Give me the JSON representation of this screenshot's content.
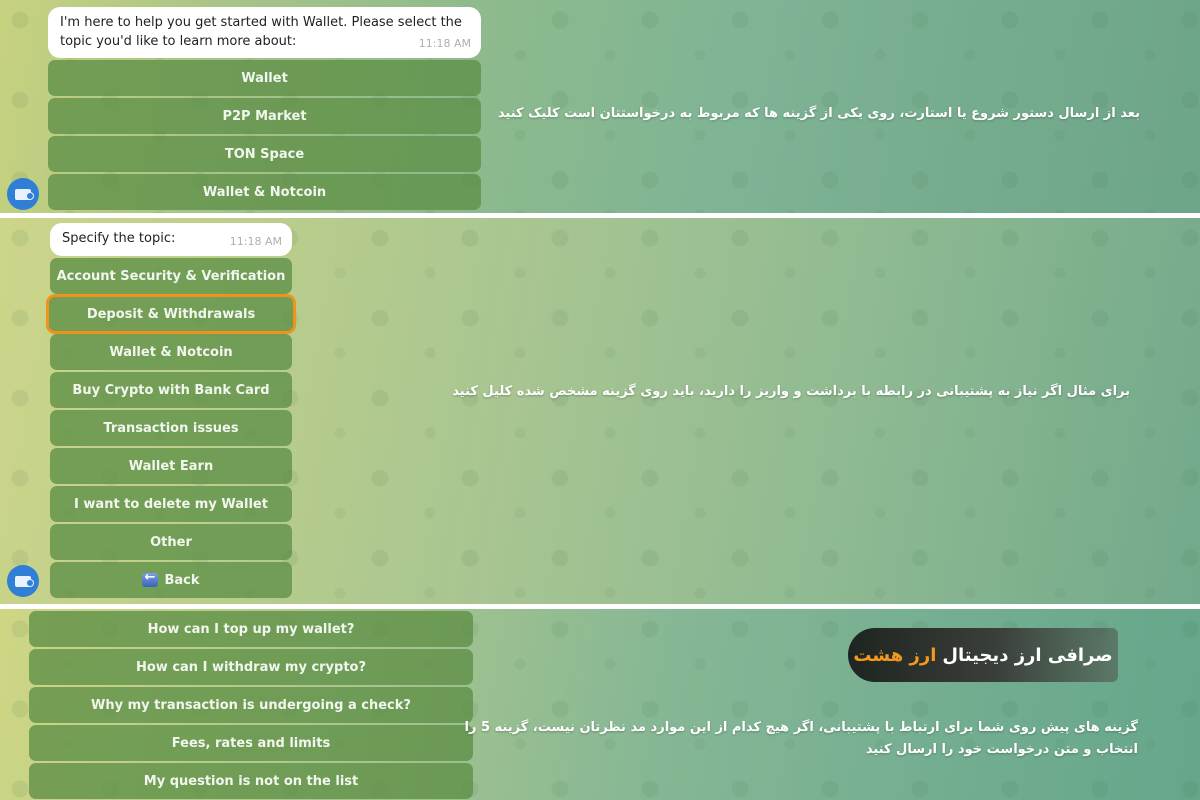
{
  "panel1": {
    "message": "I'm here to help you get started with Wallet. Please select the topic you'd like to learn more about:",
    "time": "11:18 AM",
    "buttons": [
      "Wallet",
      "P2P Market",
      "TON Space",
      "Wallet & Notcoin"
    ],
    "caption": "بعد از ارسال دستور شروع یا استارت، روی یکی از گزینه ها که مربوط به درخواستتان است کلیک کنید",
    "avatar_icon": "wallet-icon"
  },
  "panel2": {
    "message": "Specify the topic:",
    "time": "11:18 AM",
    "buttons": [
      "Account Security & Verification",
      "Deposit & Withdrawals",
      "Wallet & Notcoin",
      "Buy Crypto with Bank Card",
      "Transaction issues",
      "Wallet Earn",
      "I want to delete my Wallet",
      "Other"
    ],
    "highlighted": "Deposit & Withdrawals",
    "highlight_color": "#f0921c",
    "back_label": "Back",
    "caption": "برای مثال اگر نیاز به پشتیبانی در رابطه با برداشت و واریز را دارید، باید روی گزینه مشخص شده کلیل کنید",
    "avatar_icon": "wallet-icon"
  },
  "panel3": {
    "buttons": [
      "How can I top up my wallet?",
      "How can I withdraw my crypto?",
      "Why my transaction is undergoing a check?",
      "Fees, rates and limits",
      "My question is not on the list"
    ],
    "brand_main": "صرافی ارز دیجیتال",
    "brand_accent": "ارز هشت",
    "brand_accent_color": "#f39a1e",
    "caption_line1": "گزینه های پیش روی شما برای ارتباط با پشتیبانی، اگر هیچ کدام از این موارد مد نظرتان نیست،  گزینه 5 را",
    "caption_line2": "انتخاب و متن درخواست خود را ارسال کنید"
  }
}
